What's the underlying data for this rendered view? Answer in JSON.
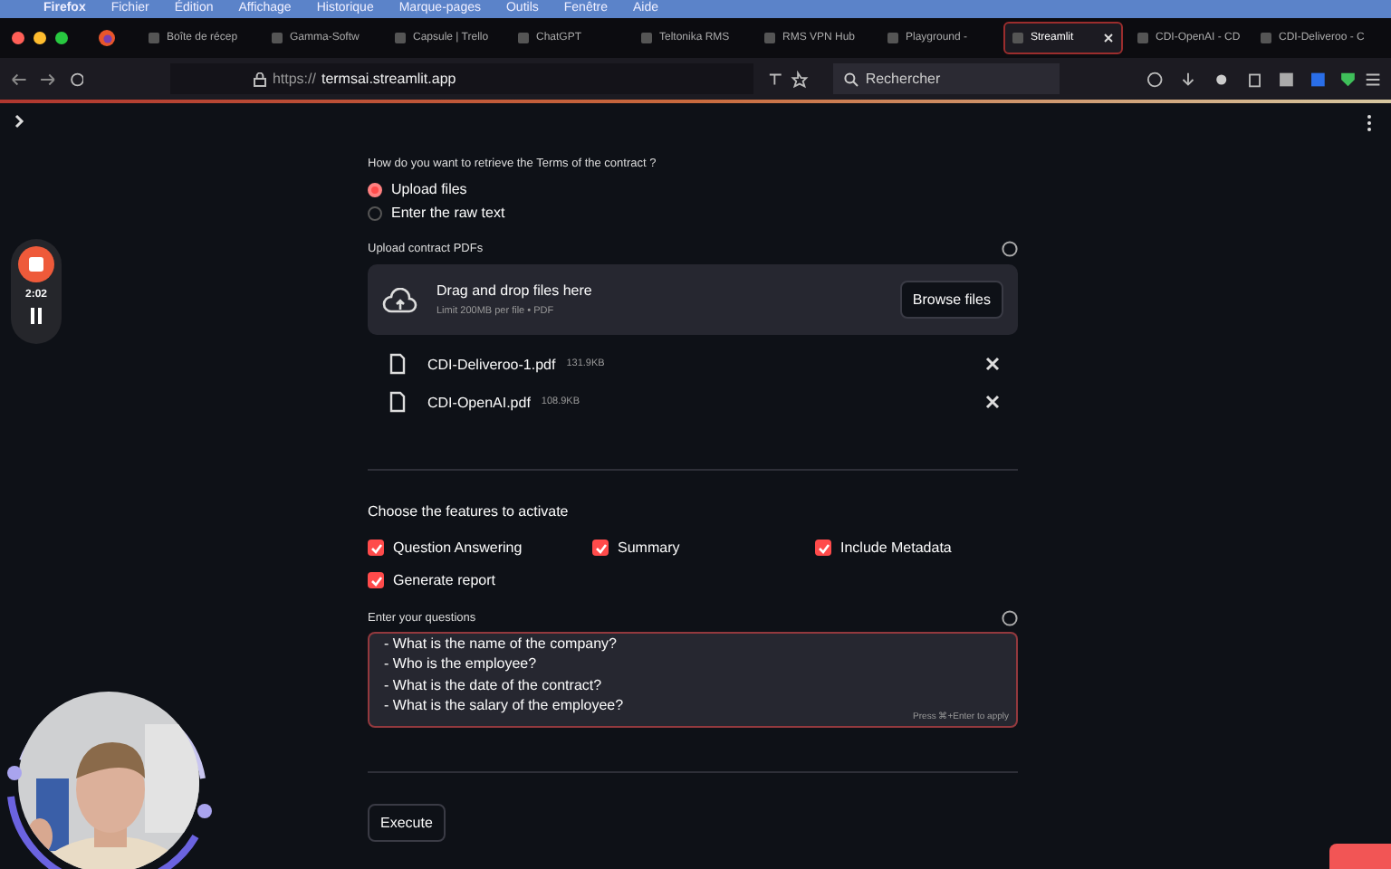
{
  "menu_bar": {
    "items": [
      "Firefox",
      "Fichier",
      "Édition",
      "Affichage",
      "Historique",
      "Marque-pages",
      "Outils",
      "Fenêtre",
      "Aide"
    ]
  },
  "tabs": [
    {
      "label": "Boîte de récep",
      "selected": false
    },
    {
      "label": "Gamma-Softw",
      "selected": false
    },
    {
      "label": "Capsule | Trello",
      "selected": false
    },
    {
      "label": "ChatGPT",
      "selected": false
    },
    {
      "label": "Teltonika RMS",
      "selected": false
    },
    {
      "label": "RMS VPN Hub",
      "selected": false
    },
    {
      "label": "Playground - ",
      "selected": false
    },
    {
      "label": "Streamlit",
      "selected": true
    },
    {
      "label": "CDI-OpenAI - CD",
      "selected": false
    },
    {
      "label": "CDI-Deliveroo - C",
      "selected": false
    }
  ],
  "address_bar": {
    "url_prefix": "https://",
    "url_host": "termsai.streamlit.app"
  },
  "search": {
    "placeholder": "Rechercher"
  },
  "recorder": {
    "time": "2:02"
  },
  "form": {
    "question": "How do you want to retrieve the Terms of the contract ?",
    "options": [
      {
        "label": "Upload files",
        "selected": true
      },
      {
        "label": "Enter the raw text",
        "selected": false
      }
    ],
    "upload_label": "Upload contract PDFs",
    "dropzone": {
      "title": "Drag and drop files here",
      "hint": "Limit 200MB per file • PDF",
      "button": "Browse files"
    },
    "files": [
      {
        "name": "CDI-Deliveroo-1.pdf",
        "size": "131.9KB"
      },
      {
        "name": "CDI-OpenAI.pdf",
        "size": "108.9KB"
      }
    ],
    "features_label": "Choose the features to activate",
    "features": [
      {
        "label": "Question Answering",
        "checked": true
      },
      {
        "label": "Summary",
        "checked": true
      },
      {
        "label": "Include Metadata",
        "checked": true
      },
      {
        "label": "Generate report",
        "checked": true
      }
    ],
    "questions_label": "Enter your questions",
    "questions": "- What is the name of the company?\n- Who is the employee?\n- What is the date of the contract?\n- What is the salary of the employee?",
    "questions_hint": "Press ⌘+Enter to apply",
    "execute": "Execute"
  }
}
